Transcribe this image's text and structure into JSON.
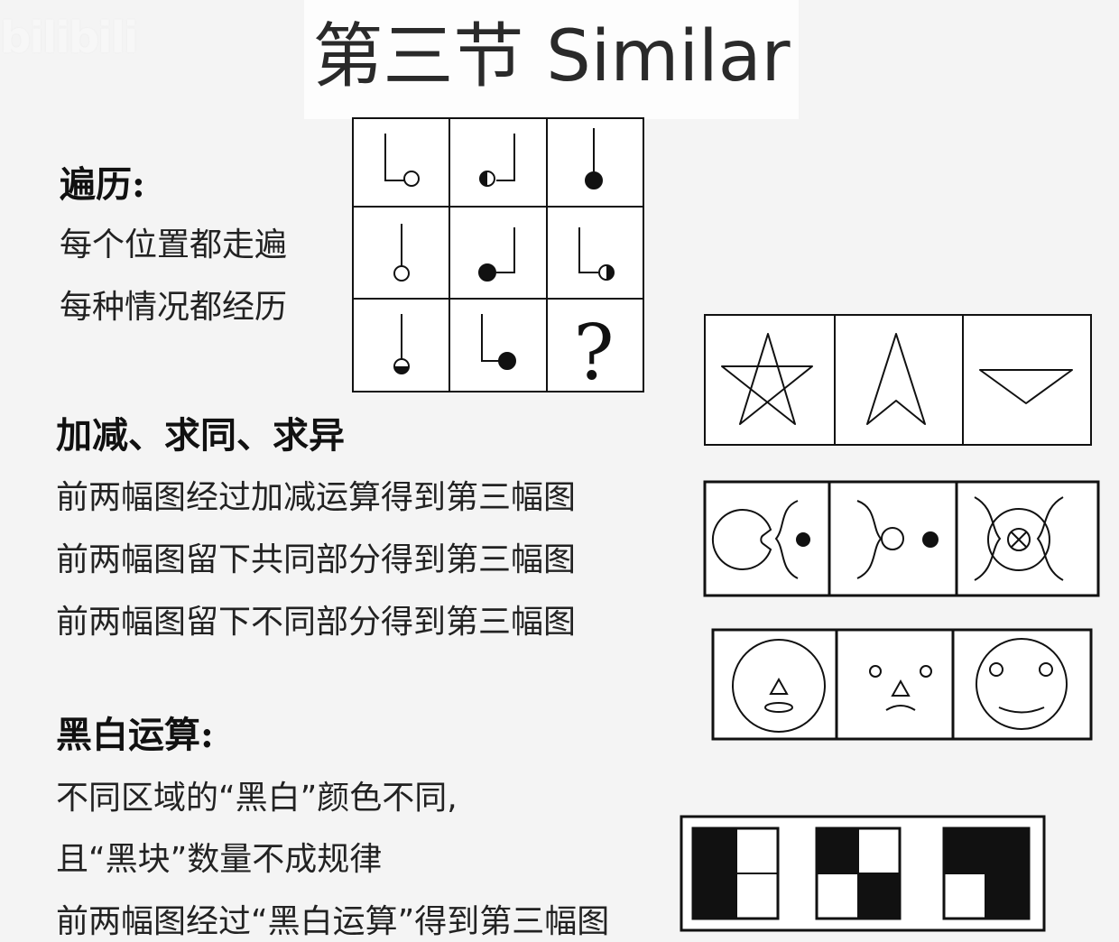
{
  "watermark": "bilibili",
  "page": {
    "title": "第三节  Similar"
  },
  "section_traverse": {
    "heading": "遍历:",
    "lines": [
      "每个位置都走遍",
      "每种情况都经历"
    ]
  },
  "section_addsub": {
    "heading": "加减、求同、求异",
    "lines": [
      "前两幅图经过加减运算得到第三幅图",
      "前两幅图留下共同部分得到第三幅图",
      "前两幅图留下不同部分得到第三幅图"
    ]
  },
  "section_bw": {
    "heading": "黑白运算:",
    "lines": [
      "不同区域的“黑白”颜色不同,",
      "且“黑块”数量不成规律",
      "前两幅图经过“黑白运算”得到第三幅图"
    ]
  },
  "grid_puzzle": {
    "question_mark": "?"
  },
  "colors": {
    "ink": "#111111",
    "background": "#f4f4f4",
    "panel": "#ffffff"
  }
}
